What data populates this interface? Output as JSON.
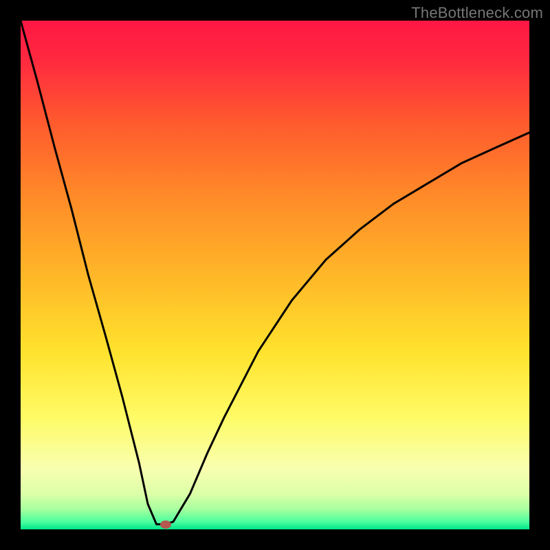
{
  "watermark": "TheBottleneck.com",
  "chart_data": {
    "type": "line",
    "title": "",
    "xlabel": "",
    "ylabel": "",
    "xlim": [
      0,
      100
    ],
    "ylim": [
      0,
      100
    ],
    "series": [
      {
        "name": "bottleneck-curve",
        "x": [
          0.0,
          3.3,
          6.7,
          10.0,
          13.3,
          16.7,
          20.0,
          23.3,
          25.0,
          26.7,
          28.3,
          30.0,
          33.3,
          36.7,
          40.0,
          46.7,
          53.3,
          60.0,
          66.7,
          73.3,
          80.0,
          86.7,
          93.3,
          100.0
        ],
        "y": [
          100.0,
          88.0,
          75.0,
          63.0,
          50.0,
          38.0,
          26.0,
          13.0,
          5.0,
          1.0,
          1.0,
          1.5,
          7.0,
          15.0,
          22.0,
          35.0,
          45.0,
          53.0,
          59.0,
          64.0,
          68.0,
          72.0,
          75.0,
          78.0
        ]
      }
    ],
    "marker": {
      "x": 28.5,
      "y": 1.0
    },
    "gradient_stops": [
      {
        "pos": 0.0,
        "color": "#ff1744"
      },
      {
        "pos": 0.08,
        "color": "#ff2a3f"
      },
      {
        "pos": 0.2,
        "color": "#ff5a2e"
      },
      {
        "pos": 0.35,
        "color": "#ff8c28"
      },
      {
        "pos": 0.5,
        "color": "#ffb728"
      },
      {
        "pos": 0.65,
        "color": "#ffe22d"
      },
      {
        "pos": 0.78,
        "color": "#fffb66"
      },
      {
        "pos": 0.88,
        "color": "#f8ffb0"
      },
      {
        "pos": 0.93,
        "color": "#dcffa8"
      },
      {
        "pos": 0.96,
        "color": "#a8ff9e"
      },
      {
        "pos": 0.985,
        "color": "#4cff9e"
      },
      {
        "pos": 1.0,
        "color": "#00e58a"
      }
    ]
  }
}
